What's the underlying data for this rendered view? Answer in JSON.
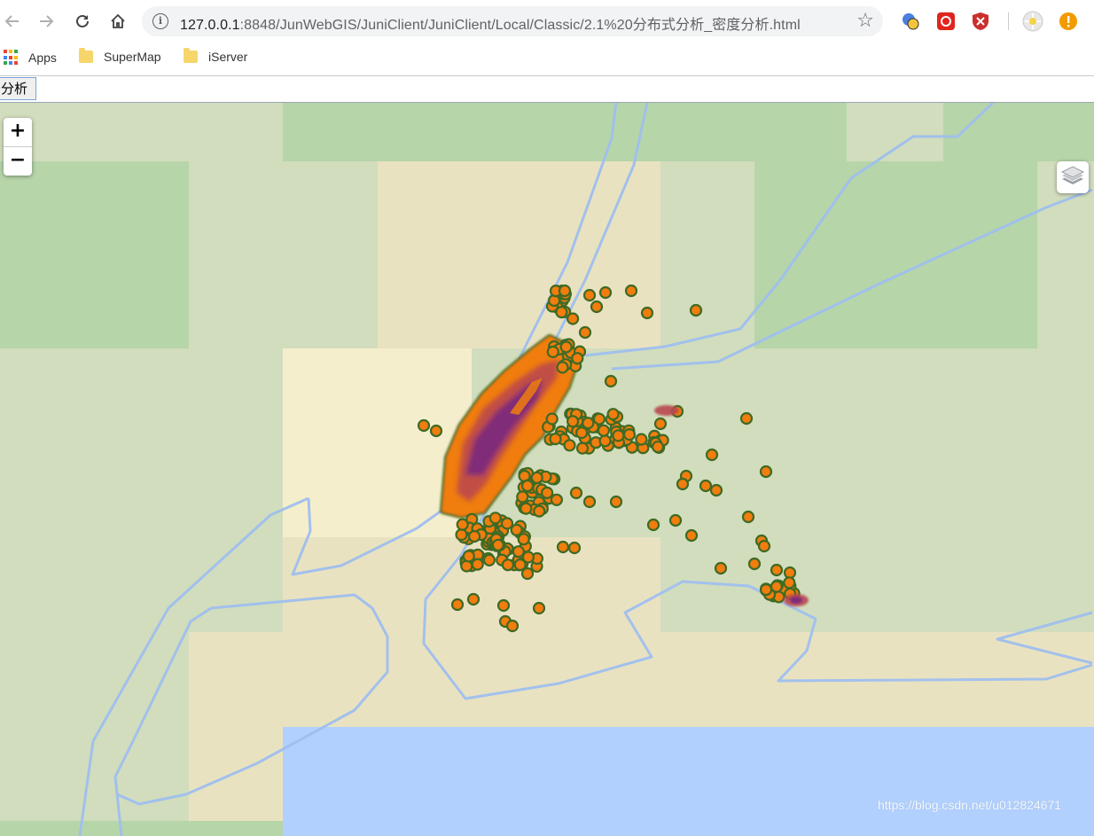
{
  "browser": {
    "url_host": "127.0.0.1",
    "url_rest": ":8848/JunWebGIS/JuniClient/JuniClient/Local/Classic/2.1%20分布式分析_密度分析.html"
  },
  "bookmarks": [
    {
      "label": "Apps",
      "icon": "apps-grid-icon"
    },
    {
      "label": "SuperMap",
      "icon": "folder-icon"
    },
    {
      "label": "iServer",
      "icon": "folder-icon"
    }
  ],
  "toolbar": {
    "analysis_button_label": "分析"
  },
  "map": {
    "zoom_in_label": "+",
    "zoom_out_label": "−",
    "colors": {
      "land": "#d1ddbd",
      "forest": "#b6d5a9",
      "beige": "#e9e2c1",
      "light_beige": "#f5eecc",
      "water": "#b1d0fe",
      "boundary": "#9fbfef",
      "density_high": "#7a2a7f",
      "density_mid": "#b8474f",
      "density_low": "#f07d0e",
      "density_edge": "#3f6a24"
    }
  },
  "watermark": "https://blog.csdn.net/u012824671"
}
